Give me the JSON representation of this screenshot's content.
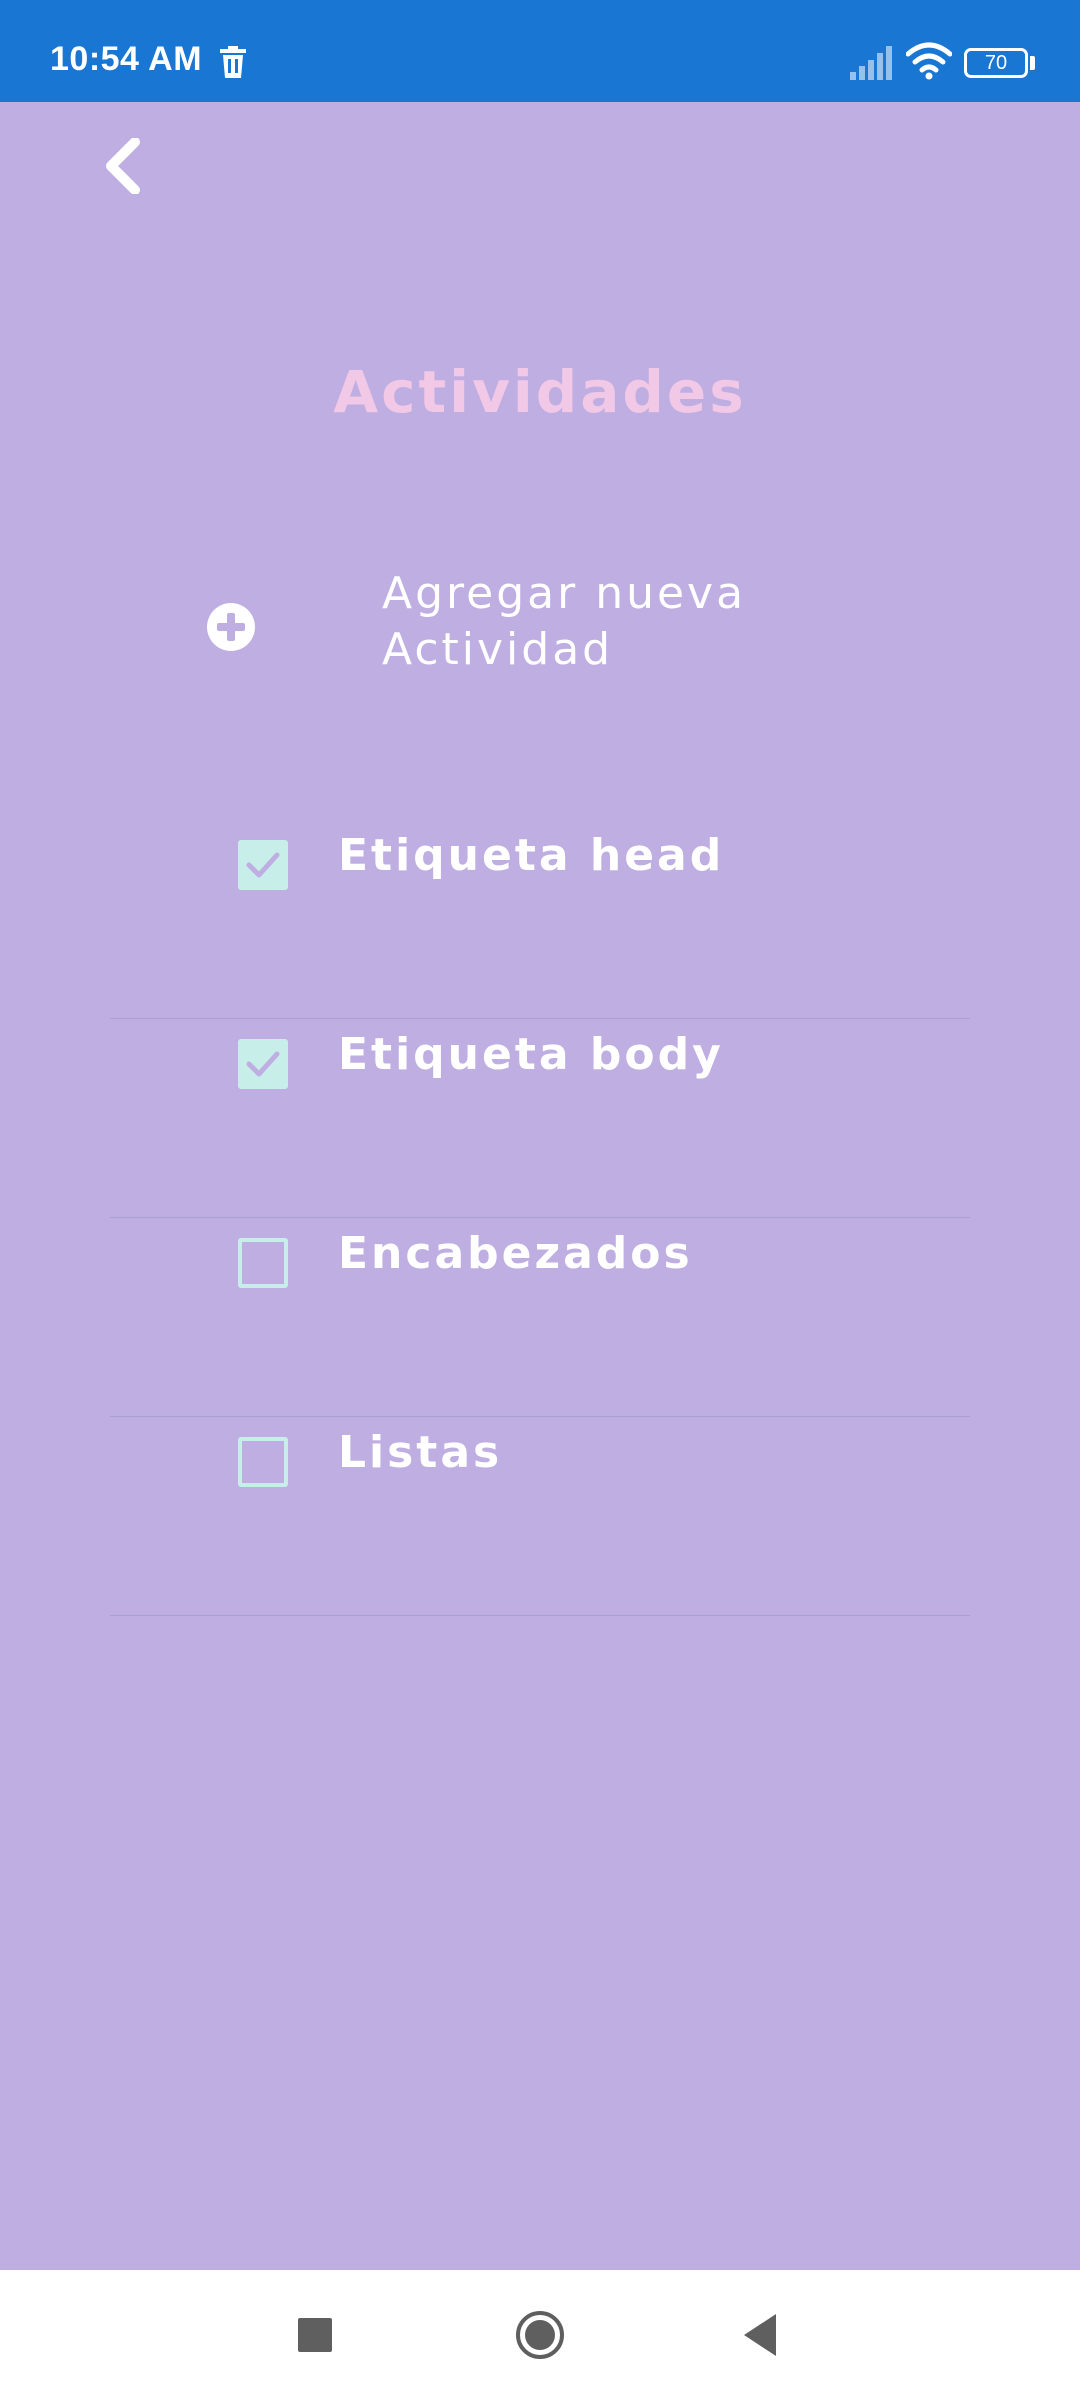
{
  "status_bar": {
    "time": "10:54 AM",
    "battery": "70",
    "icons": [
      "trash-icon",
      "signal-icon",
      "wifi-icon",
      "battery-icon"
    ]
  },
  "header": {
    "back_icon": "chevron-left-icon",
    "title": "Actividades"
  },
  "add_activity": {
    "icon": "plus-circle-icon",
    "label": "Agregar nueva Actividad"
  },
  "activities": [
    {
      "label": "Etiqueta head",
      "checked": true
    },
    {
      "label": "Etiqueta body",
      "checked": true
    },
    {
      "label": "Encabezados",
      "checked": false
    },
    {
      "label": "Listas",
      "checked": false
    }
  ],
  "nav_bar": {
    "icons": [
      "recents-icon",
      "home-icon",
      "back-icon"
    ]
  },
  "colors": {
    "background": "#BFAEE2",
    "status_bar": "#1976D2",
    "title": "#F1C8E6",
    "checkbox": "#C8EEEA",
    "text": "#FFFFFF"
  }
}
